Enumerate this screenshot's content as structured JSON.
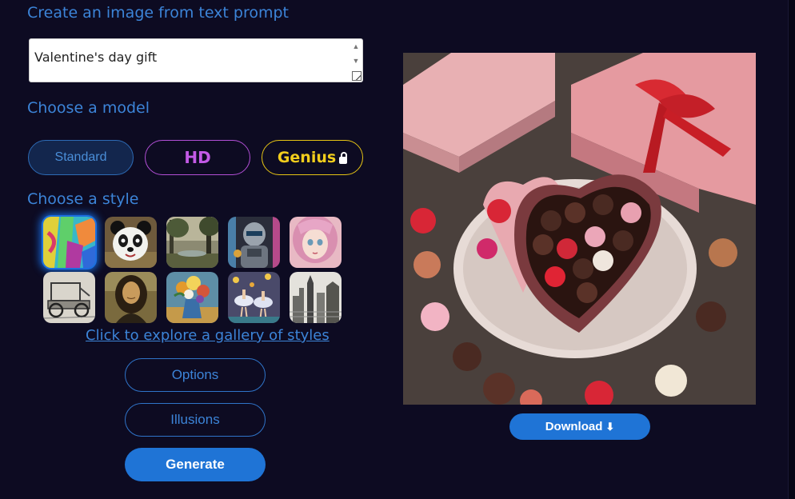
{
  "headings": {
    "prompt": "Create an image from text prompt",
    "model": "Choose a model",
    "style": "Choose a style"
  },
  "prompt": {
    "value": "Valentine's day gift"
  },
  "models": {
    "standard": "Standard",
    "hd": "HD",
    "genius": "Genius"
  },
  "styles": {
    "icons": [
      "abstract-painting",
      "panda",
      "forest-landscape",
      "robot-warrior",
      "anime-girl",
      "vintage-car-sketch",
      "mona-lisa",
      "flower-vase",
      "ballet-dancers",
      "city-sketch"
    ],
    "selected_index": 0,
    "gallery_link": "Click to explore a gallery of styles"
  },
  "actions": {
    "options": "Options",
    "illusions": "Illusions",
    "generate": "Generate",
    "download": "Download"
  },
  "colors": {
    "background": "#0d0b22",
    "accent": "#3c84d8",
    "primary_button": "#1f74d6",
    "hd": "#c35ae6",
    "genius": "#f2cd1c"
  }
}
